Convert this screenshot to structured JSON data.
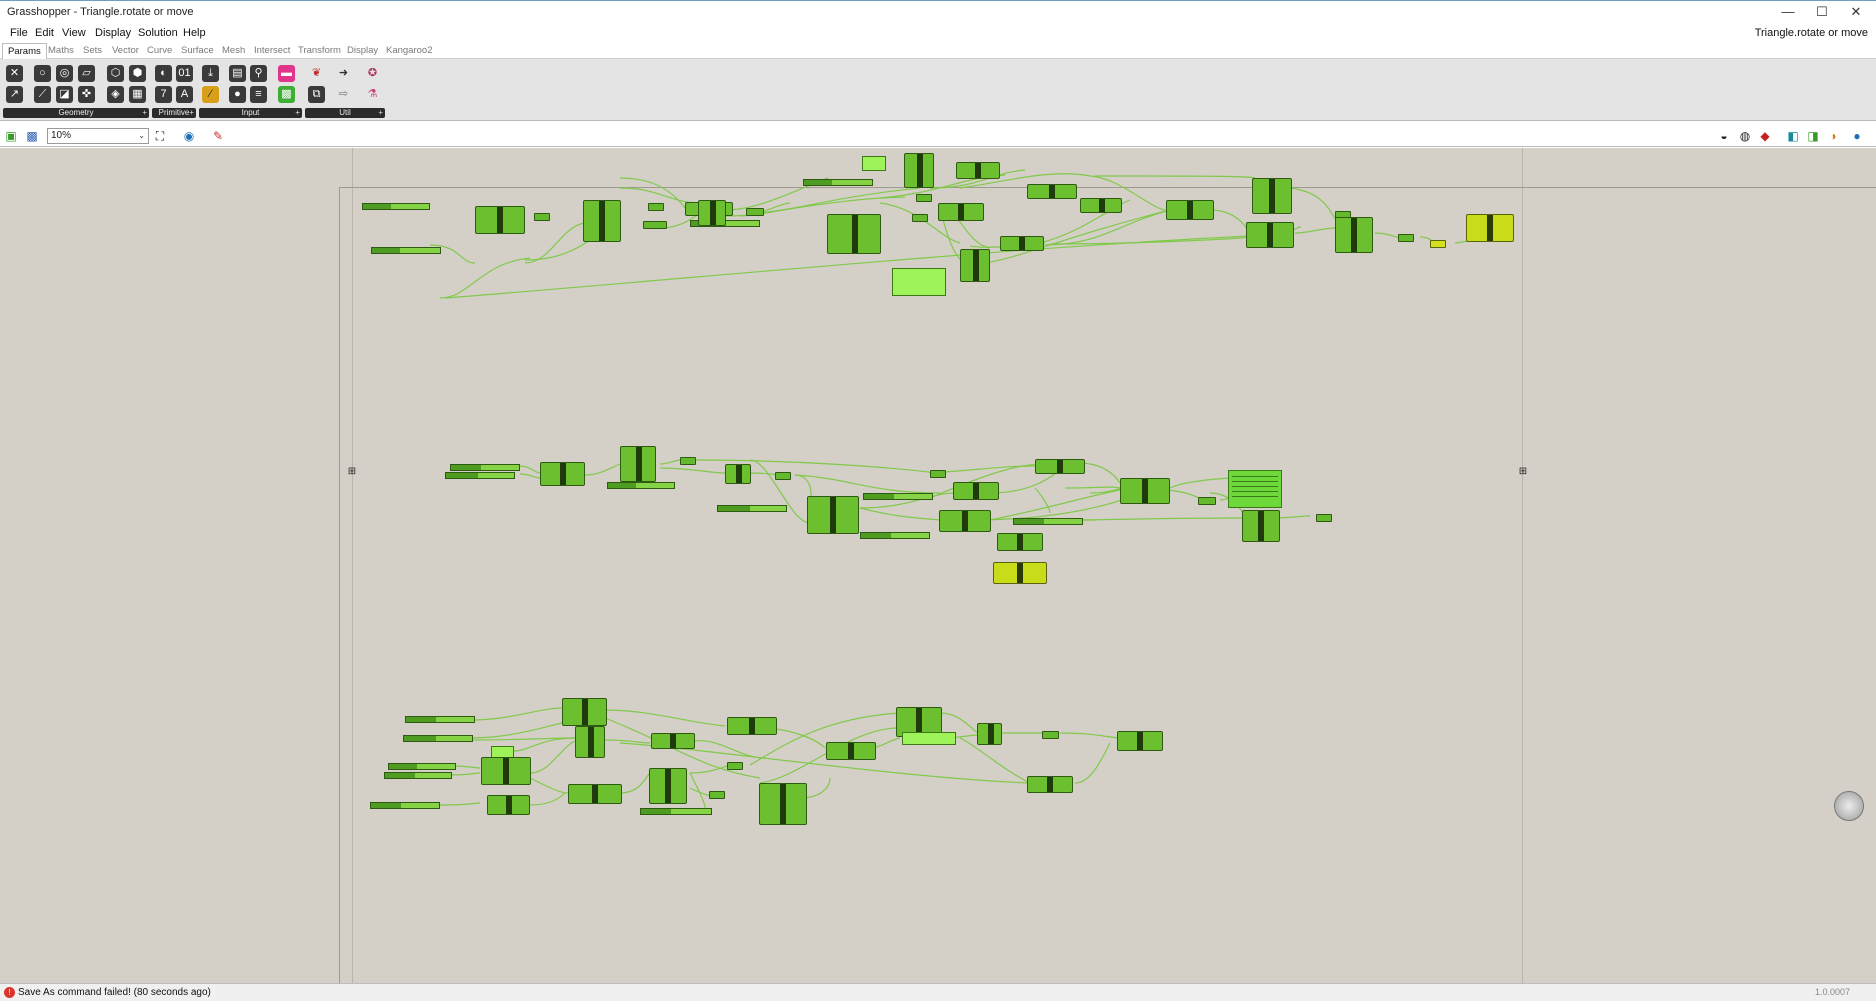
{
  "app": {
    "title": "Grasshopper - Triangle.rotate or move",
    "document_name": "Triangle.rotate or move"
  },
  "window_controls": {
    "minimize": "—",
    "maximize": "☐",
    "close": "✕"
  },
  "menus": [
    "File",
    "Edit",
    "View",
    "Display",
    "Solution",
    "Help"
  ],
  "tabs": [
    "Params",
    "Maths",
    "Sets",
    "Vector",
    "Curve",
    "Surface",
    "Mesh",
    "Intersect",
    "Transform",
    "Display",
    "Kangaroo2"
  ],
  "active_tab": "Params",
  "ribbon_groups": [
    {
      "label": "Geometry",
      "plus": "+"
    },
    {
      "label": "Primitive",
      "plus": "+"
    },
    {
      "label": "Input",
      "plus": "+"
    },
    {
      "label": "Util",
      "plus": "+"
    }
  ],
  "canvas_toolbar": {
    "zoom": "10%",
    "zoom_arrow": "⌄"
  },
  "colors": {
    "canvas": "#d4d0c8",
    "component": "#6cbf2e",
    "selected_component": "#c8dc1a",
    "wire": "#7cc843"
  },
  "status": {
    "message": "Save As command failed! (80 seconds ago)",
    "version": "1.0.0007",
    "error_icon": "!"
  }
}
